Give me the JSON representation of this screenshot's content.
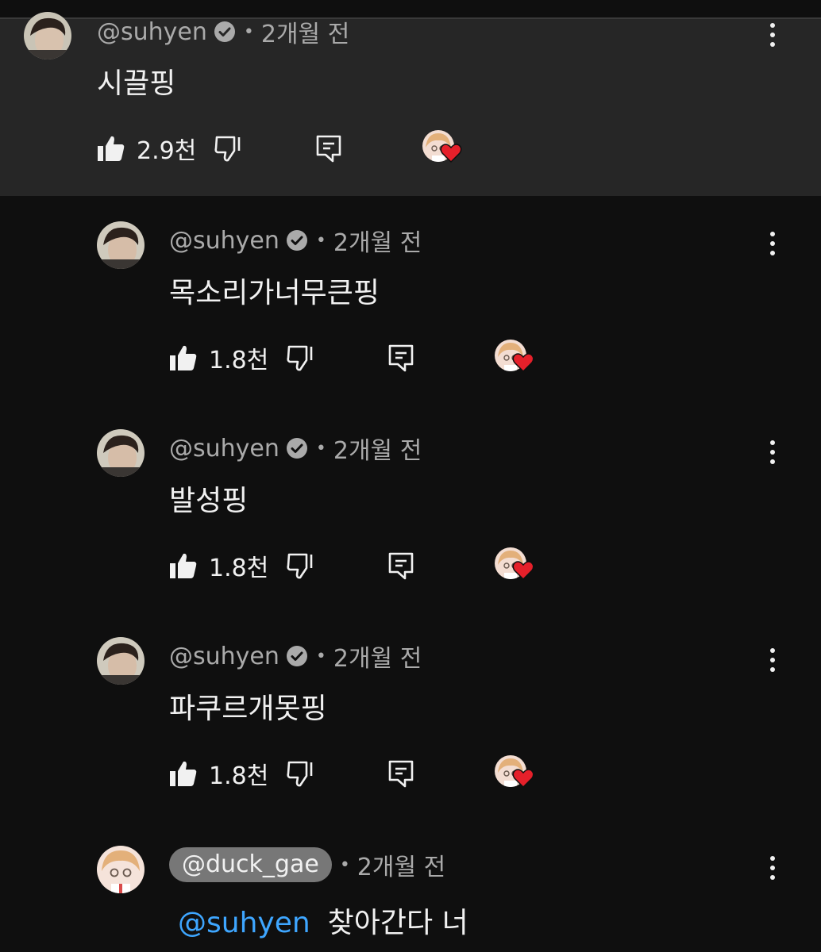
{
  "comments": [
    {
      "handle": "@suhyen",
      "verified": true,
      "time": "2개월 전",
      "text": "시끌핑",
      "likes": "2.9천",
      "highlighted": true,
      "avatar": "person-avatar"
    },
    {
      "handle": "@suhyen",
      "verified": true,
      "time": "2개월 전",
      "text": "목소리가너무큰핑",
      "likes": "1.8천",
      "avatar": "person-avatar"
    },
    {
      "handle": "@suhyen",
      "verified": true,
      "time": "2개월 전",
      "text": "발성핑",
      "likes": "1.8천",
      "avatar": "person-avatar"
    },
    {
      "handle": "@suhyen",
      "verified": true,
      "time": "2개월 전",
      "text": "파쿠르개못핑",
      "likes": "1.8천",
      "avatar": "person-avatar"
    },
    {
      "handle": "@duck_gae",
      "creator": true,
      "time": "2개월 전",
      "mention": "@suhyen",
      "text": "찾아간다 너",
      "avatar": "cartoon-avatar"
    }
  ],
  "colors": {
    "background": "#0f0f0f",
    "highlight": "#262626",
    "mention": "#3ea6ff",
    "heart": "#e5202a",
    "secondary_text": "#aaaaaa"
  },
  "icons": [
    "verified-icon",
    "like-icon",
    "dislike-icon",
    "reply-icon",
    "creator-heart-icon",
    "more-options-icon"
  ]
}
